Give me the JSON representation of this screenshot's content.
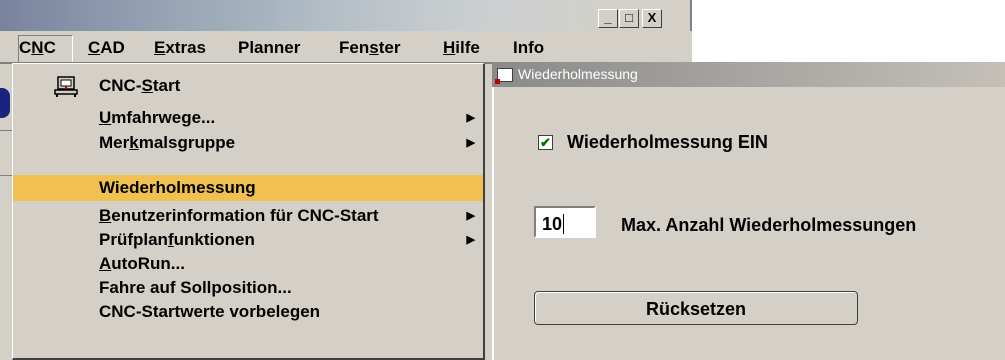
{
  "window": {
    "controls": [
      "_",
      "□",
      "X"
    ]
  },
  "menubar": {
    "items": [
      {
        "pre": "C",
        "u": "N",
        "post": "C"
      },
      {
        "pre": "",
        "u": "C",
        "post": "AD"
      },
      {
        "pre": "",
        "u": "E",
        "post": "xtras"
      },
      {
        "pre": "Planner",
        "u": "",
        "post": ""
      },
      {
        "pre": "Fen",
        "u": "s",
        "post": "ter"
      },
      {
        "pre": "",
        "u": "H",
        "post": "ilfe"
      },
      {
        "pre": "Info",
        "u": "",
        "post": ""
      }
    ]
  },
  "dropdown": {
    "items": [
      {
        "pre": "CNC-",
        "u": "S",
        "post": "tart",
        "arrow": "",
        "icon": "cnc-start-icon"
      },
      {
        "pre": "",
        "u": "U",
        "post": "mfahrwege...",
        "arrow": "▶"
      },
      {
        "pre": "Mer",
        "u": "k",
        "post": "malsgruppe",
        "arrow": "▶"
      },
      {
        "pre": "Wiederholmessung",
        "u": "",
        "post": "",
        "arrow": "",
        "highlighted": true
      },
      {
        "pre": "",
        "u": "B",
        "post": "enutzerinformation für CNC-Start",
        "arrow": "▶"
      },
      {
        "pre": "Prüfplan",
        "u": "f",
        "post": "unktionen",
        "arrow": "▶"
      },
      {
        "pre": "",
        "u": "A",
        "post": "utoRun...",
        "arrow": ""
      },
      {
        "pre": "Fahre auf Sollposition...",
        "u": "",
        "post": "",
        "arrow": ""
      },
      {
        "pre": "CNC-Startwerte vorbelegen",
        "u": "",
        "post": "",
        "arrow": ""
      }
    ],
    "highlight_color": "#f0c050"
  },
  "dialog": {
    "title": "Wiederholmessung",
    "checkbox_label": "Wiederholmessung EIN",
    "checkbox_checked": true,
    "checkbox_mark": "✔",
    "count_value": "10",
    "count_label": "Max. Anzahl Wiederholmessungen",
    "reset_label": "Rücksetzen"
  }
}
